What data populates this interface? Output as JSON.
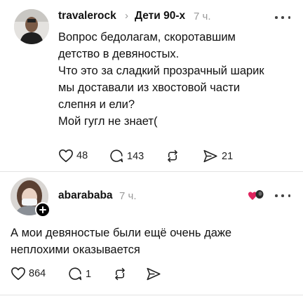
{
  "post1": {
    "author": "travalerock",
    "topic": "Дети 90-х",
    "time": "7 ч.",
    "lines": [
      "Вопрос бедолагам, скоротавшим",
      "детство в девяностых.",
      "Что это за сладкий прозрачный шарик",
      "мы доставали из хвостовой части",
      "слепня и ели?",
      "Мой гугл не знает("
    ],
    "likes": "48",
    "replies": "143",
    "shares": "21"
  },
  "post2": {
    "author": "abarababa",
    "time": "7 ч.",
    "lines": [
      "А мои девяностые были ещё очень даже",
      "неплохими оказывается"
    ],
    "likes": "864",
    "replies": "1"
  },
  "colors": {
    "text": "#111111",
    "muted": "#9a9a9a",
    "divider": "#e3e3e3",
    "reaction_heart": "#e0245e"
  },
  "icons": [
    "avatar-travalerock",
    "chevron-right-icon",
    "more-icon",
    "heart-icon",
    "reply-icon",
    "repost-icon",
    "share-icon",
    "follow-plus-icon",
    "reaction-heart-icon"
  ]
}
